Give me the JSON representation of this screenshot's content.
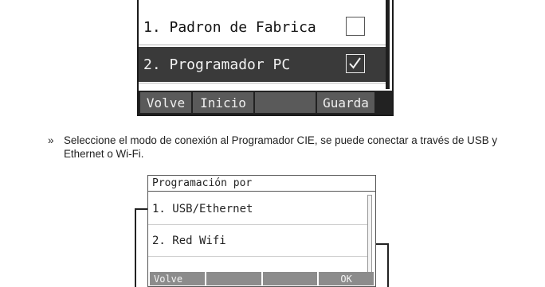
{
  "screen1": {
    "items": [
      {
        "label": "1. Padron de Fabrica",
        "checked": false
      },
      {
        "label": "2. Programador PC",
        "checked": true
      }
    ],
    "softkeys": [
      "Volve",
      "Inicio",
      "",
      "Guarda"
    ]
  },
  "instruction": {
    "bullet": "»",
    "text": "Seleccione el modo de conexión al Programador CIE, se puede conectar a través de USB y Ethernet o Wi-Fi."
  },
  "screen2": {
    "title": "Programación por",
    "items": [
      {
        "label": "1. USB/Ethernet"
      },
      {
        "label": "2. Red Wifi"
      }
    ],
    "softkeys": [
      "Volve",
      "",
      "",
      "OK"
    ]
  },
  "colors": {
    "selected_row": "#3a3a3a",
    "softkey_dark": "#5a5a5a",
    "softkey_light": "#8c8c8c"
  },
  "icons": {
    "checked": "checkbox-checked-icon",
    "unchecked": "checkbox-unchecked-icon"
  }
}
